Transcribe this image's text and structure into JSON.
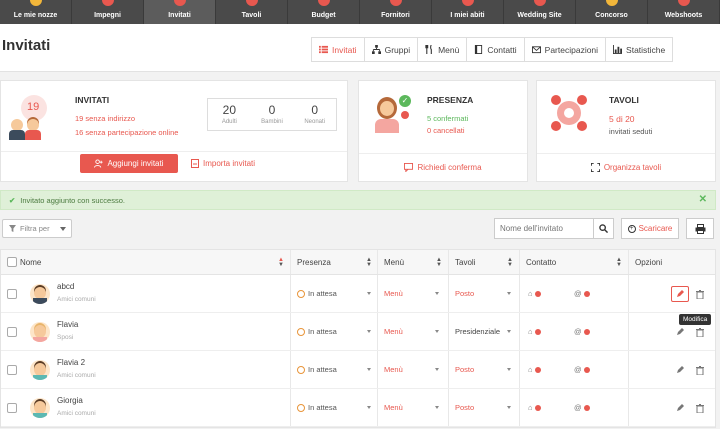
{
  "nav": [
    "Le mie nozze",
    "Impegni",
    "Invitati",
    "Tavoli",
    "Budget",
    "Fornitori",
    "I miei abiti",
    "Wedding Site",
    "Concorso",
    "Webshoots"
  ],
  "page_title": "Invitati",
  "tabs": [
    "Invitati",
    "Gruppi",
    "Menù",
    "Contatti",
    "Partecipazioni",
    "Statistiche"
  ],
  "invitati_card": {
    "title": "INVITATI",
    "count": "19",
    "line1": "19 senza indirizzo",
    "line2": "16 senza partecipazione online",
    "stats": [
      {
        "n": "20",
        "l": "Adulti"
      },
      {
        "n": "0",
        "l": "Bambini"
      },
      {
        "n": "0",
        "l": "Neonati"
      }
    ],
    "add_button": "Aggiungi invitati",
    "import_link": "Importa invitati"
  },
  "presenza_card": {
    "title": "PRESENZA",
    "confirmed": "5 confermati",
    "cancelled": "0 cancellati",
    "link": "Richiedi conferma"
  },
  "tavoli_card": {
    "title": "TAVOLI",
    "ratio": "5 di 20",
    "seated": "invitati seduti",
    "link": "Organizza tavoli"
  },
  "alert": "Invitato aggiunto con successo.",
  "filter_label": "Filtra per",
  "search_placeholder": "Nome dell'invitato",
  "download_label": "Scaricare",
  "columns": [
    "Nome",
    "Presenza",
    "Menù",
    "Tavoli",
    "Contatto",
    "Opzioni"
  ],
  "rows": [
    {
      "name": "abcd",
      "sub": "Amici comuni",
      "presenza": "In attesa",
      "menu": "Menù",
      "tavolo": "Posto"
    },
    {
      "name": "Flavia",
      "sub": "Sposi",
      "presenza": "In attesa",
      "menu": "Menù",
      "tavolo": "Presidenziale"
    },
    {
      "name": "Flavia 2",
      "sub": "Amici comuni",
      "presenza": "In attesa",
      "menu": "Menù",
      "tavolo": "Posto"
    },
    {
      "name": "Giorgia",
      "sub": "Amici comuni",
      "presenza": "In attesa",
      "menu": "Menù",
      "tavolo": "Posto"
    }
  ],
  "tooltip": "Modifica",
  "colors": {
    "accent": "#e8584f",
    "success": "#5cb85c",
    "nav": "#4a4a4a"
  }
}
